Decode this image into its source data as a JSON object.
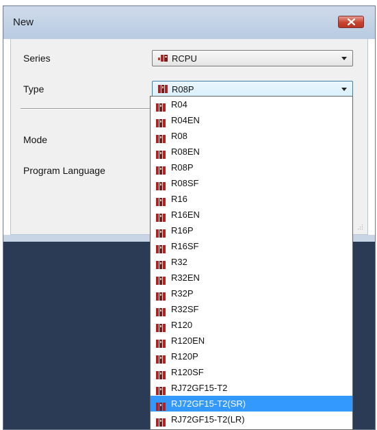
{
  "dialog": {
    "title": "New"
  },
  "form": {
    "series_label": "Series",
    "series_value": "RCPU",
    "type_label": "Type",
    "type_value": "R08P",
    "mode_label": "Mode",
    "language_label": "Program Language"
  },
  "dropdown": {
    "items": [
      "R04",
      "R04EN",
      "R08",
      "R08EN",
      "R08P",
      "R08SF",
      "R16",
      "R16EN",
      "R16P",
      "R16SF",
      "R32",
      "R32EN",
      "R32P",
      "R32SF",
      "R120",
      "R120EN",
      "R120P",
      "R120SF",
      "RJ72GF15-T2",
      "RJ72GF15-T2(SR)",
      "RJ72GF15-T2(LR)"
    ],
    "selected_index": 19
  },
  "colors": {
    "highlight": "#3399ff",
    "background_dark": "#2b3b55",
    "close_button": "#c8432f"
  },
  "icons": {
    "close": "close-x-icon",
    "series": "cpu-module-icon",
    "item": "plc-module-icon"
  }
}
